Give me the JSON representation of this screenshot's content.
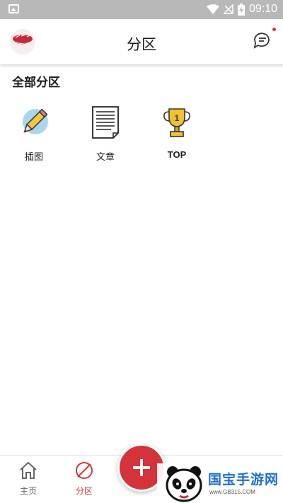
{
  "status_bar": {
    "time": "09:10"
  },
  "header": {
    "title": "分区"
  },
  "section": {
    "title": "全部分区"
  },
  "categories": [
    {
      "label": "插图",
      "icon": "pencil-icon"
    },
    {
      "label": "文章",
      "icon": "document-icon"
    },
    {
      "label": "TOP",
      "icon": "trophy-icon",
      "badge": "1"
    }
  ],
  "bottom_nav": {
    "items": [
      {
        "label": "主页",
        "icon": "home-icon"
      },
      {
        "label": "分区",
        "icon": "leaf-icon",
        "active": true
      }
    ]
  },
  "watermark": {
    "text": "国宝手游网",
    "url": "www.GB315.COM"
  },
  "colors": {
    "accent": "#d4333b",
    "inactive": "#666666",
    "status_bar": "#b8b8b8"
  }
}
